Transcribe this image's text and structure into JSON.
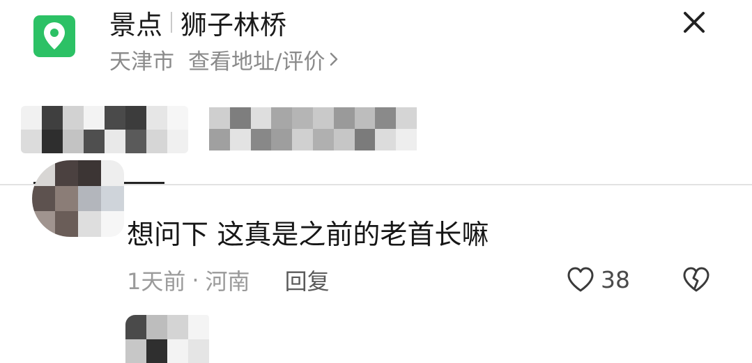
{
  "header": {
    "category": "景点",
    "name": "狮子林桥",
    "city": "天津市",
    "address_link": "查看地址/评价",
    "colors": {
      "accent": "#2cc165"
    }
  },
  "comment": {
    "text": "想问下 这真是之前的老首长嘛",
    "time": "1天前",
    "separator": "·",
    "location": "河南",
    "reply_label": "回复",
    "likes": "38"
  },
  "icons": {
    "location": "map-pin-icon",
    "close": "close-icon",
    "like": "heart-icon",
    "dislike": "broken-heart-icon",
    "chevron": "chevron-right-icon"
  }
}
